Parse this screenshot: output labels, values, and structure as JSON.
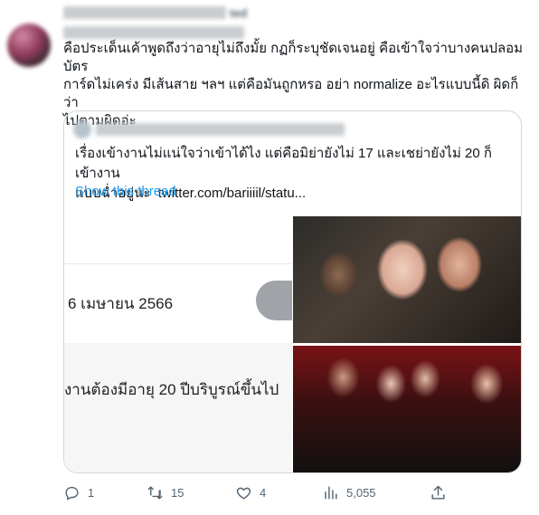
{
  "retweet_header": {
    "text": "ted"
  },
  "tweet": {
    "text": "คือประเด็นเค้าพูดถึงว่าอายุไม่ถึงมั้ย กฏก็ระบุชัดเจนอยู่ คือเข้าใจว่าบางคนปลอมบัตร\nการ์ดไม่เคร่ง มีเส้นสาย ฯลฯ แต่คือมันถูกหรอ อย่า normalize อะไรแบบนี้ดิ ผิดก็ว่า\nไปตามผิดอ่ะ"
  },
  "quoted_tweet": {
    "text": "เรื่องเข้างานไม่แน่ใจว่าเข้าได้ไง แต่คือมิย่ายังไม่ 17 และเชย่ายังไม่ 20 ก็เข้างาน\nแบบฉ่ำอยู่นะ  twitter.com/bariiiil/statu...",
    "show_thread": "Show this thread",
    "media": {
      "date_text": "6 เมษายน 2566",
      "age_rule_text": "งานต้องมีอายุ 20 ปีบริบูรณ์ขึ้นไป"
    }
  },
  "actions": {
    "reply_count": "1",
    "retweet_count": "15",
    "like_count": "4",
    "views_count": "5,055"
  },
  "icons": [
    "reply-icon",
    "retweet-icon",
    "like-icon",
    "views-icon",
    "share-icon"
  ],
  "colors": {
    "link": "#1d9bf0",
    "muted": "#536471",
    "border": "#cfd9de"
  }
}
